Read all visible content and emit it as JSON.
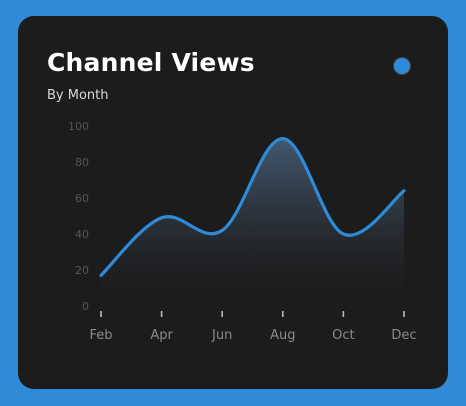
{
  "card": {
    "title": "Channel Views",
    "subtitle": "By Month",
    "accent": "#2f8ad8"
  },
  "chart_data": {
    "type": "area",
    "title": "Channel Views",
    "subtitle": "By Month",
    "xlabel": "",
    "ylabel": "",
    "x_tick_labels": [
      "Feb",
      "Apr",
      "Jun",
      "Aug",
      "Oct",
      "Dec"
    ],
    "y_ticks": [
      0,
      20,
      40,
      60,
      80,
      100
    ],
    "ylim": [
      0,
      100
    ],
    "grid": false,
    "legend": "none",
    "series": [
      {
        "x": [
          "Feb",
          "Apr",
          "Jun",
          "Aug",
          "Oct",
          "Dec"
        ],
        "values": [
          17,
          49,
          42,
          93,
          40,
          64
        ],
        "color": "#2f8ad8"
      }
    ]
  }
}
